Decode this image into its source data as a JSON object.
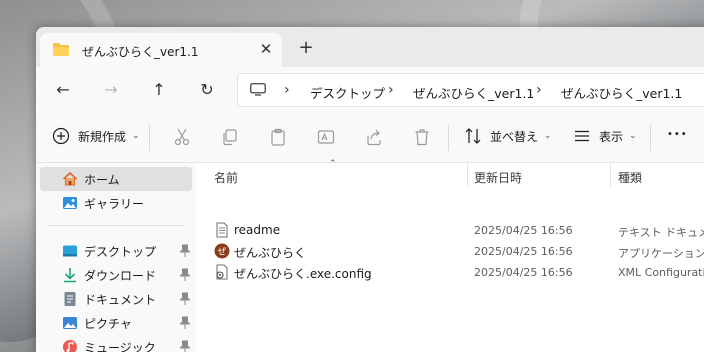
{
  "tab": {
    "title": "ぜんぶひらく_ver1.1",
    "close_glyph": "✕",
    "new_tab_glyph": "+"
  },
  "nav": {
    "back": "←",
    "forward": "→",
    "up": "↑",
    "refresh": "↻"
  },
  "address": {
    "sep": "›",
    "crumbs": [
      "デスクトップ",
      "ぜんぶひらく_ver1.1",
      "ぜんぶひらく_ver1.1"
    ]
  },
  "toolbar": {
    "new_label": "新規作成",
    "sort_label": "並べ替え",
    "view_label": "表示",
    "more_label": "•••"
  },
  "sidebar": {
    "items": [
      {
        "label": "ホーム",
        "icon": "home-icon"
      },
      {
        "label": "ギャラリー",
        "icon": "gallery-icon"
      },
      {
        "label": "デスクトップ",
        "icon": "desktop-icon"
      },
      {
        "label": "ダウンロード",
        "icon": "download-icon"
      },
      {
        "label": "ドキュメント",
        "icon": "documents-icon"
      },
      {
        "label": "ピクチャ",
        "icon": "pictures-icon"
      },
      {
        "label": "ミュージック",
        "icon": "music-icon"
      }
    ]
  },
  "columns": {
    "name": "名前",
    "date": "更新日時",
    "type": "種類"
  },
  "files": [
    {
      "name": "readme",
      "date": "2025/04/25 16:56",
      "type": "テキスト ドキュメント",
      "icon": "text-file-icon"
    },
    {
      "name": "ぜんぶひらく",
      "date": "2025/04/25 16:56",
      "type": "アプリケーション",
      "icon": "app-icon"
    },
    {
      "name": "ぜんぶひらく.exe.config",
      "date": "2025/04/25 16:56",
      "type": "XML Configuration",
      "icon": "config-file-icon"
    }
  ],
  "colors": {
    "accent": "#0067c0",
    "folder": "#f6c342",
    "selected": "#e0e0e0"
  }
}
